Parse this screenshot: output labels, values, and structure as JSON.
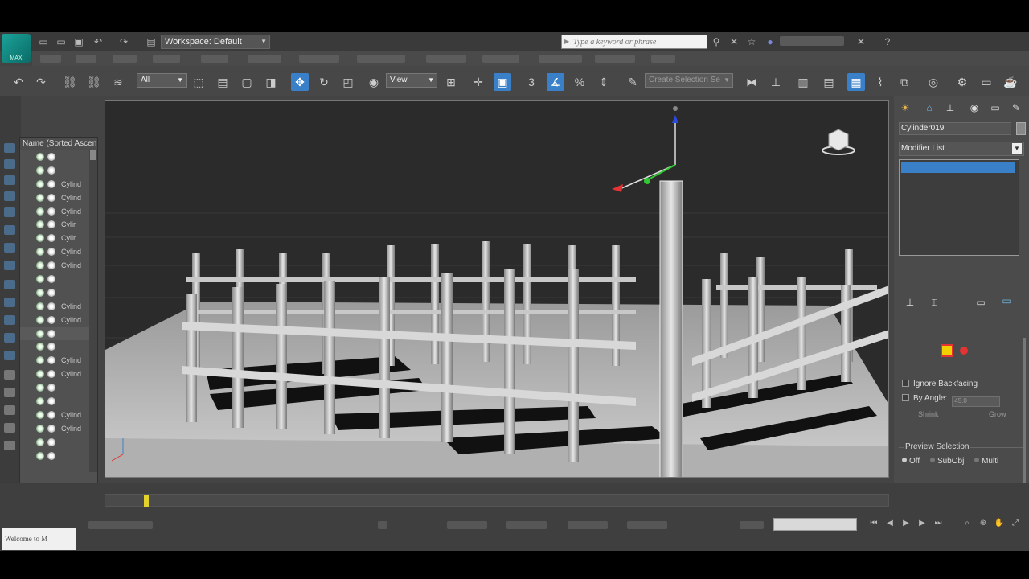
{
  "app": {
    "logo_text": "MAX"
  },
  "titlebar": {
    "workspace_label": "Workspace: Default",
    "search_placeholder": "Type a keyword or phrase"
  },
  "toolbar": {
    "filter_value": "All",
    "ref_coord_value": "View",
    "named_selection_placeholder": "Create Selection Se"
  },
  "scene_explorer": {
    "header": "Name (Sorted Ascen",
    "rows": [
      {
        "name": ""
      },
      {
        "name": ""
      },
      {
        "name": "Cylind"
      },
      {
        "name": "Cylind"
      },
      {
        "name": "Cylind"
      },
      {
        "name": "Cylir"
      },
      {
        "name": "Cylir"
      },
      {
        "name": "Cylind"
      },
      {
        "name": "Cylind"
      },
      {
        "name": ""
      },
      {
        "name": ""
      },
      {
        "name": "Cylind"
      },
      {
        "name": "Cylind"
      },
      {
        "name": ""
      },
      {
        "name": ""
      },
      {
        "name": "Cylind"
      },
      {
        "name": "Cylind"
      },
      {
        "name": ""
      },
      {
        "name": ""
      },
      {
        "name": "Cylind"
      },
      {
        "name": "Cylind"
      },
      {
        "name": ""
      },
      {
        "name": ""
      }
    ]
  },
  "command_panel": {
    "object_name": "Cylinder019",
    "modifier_list_label": "Modifier List",
    "ignore_backfacing_label": "Ignore Backfacing",
    "by_angle_label": "By Angle:",
    "by_angle_value": "45.0",
    "shrink_label": "Shrink",
    "grow_label": "Grow",
    "preview_selection_label": "Preview Selection",
    "preview_off_label": "Off",
    "preview_subobj_label": "SubObj",
    "preview_multi_label": "Multi"
  },
  "bottom": {
    "maxscript_text": "Welcome to M"
  },
  "colors": {
    "accent_blue": "#3a80c8",
    "vertex_red": "#e53232",
    "vertex_yellow": "#f0d000",
    "time_slider": "#e2d22c"
  }
}
